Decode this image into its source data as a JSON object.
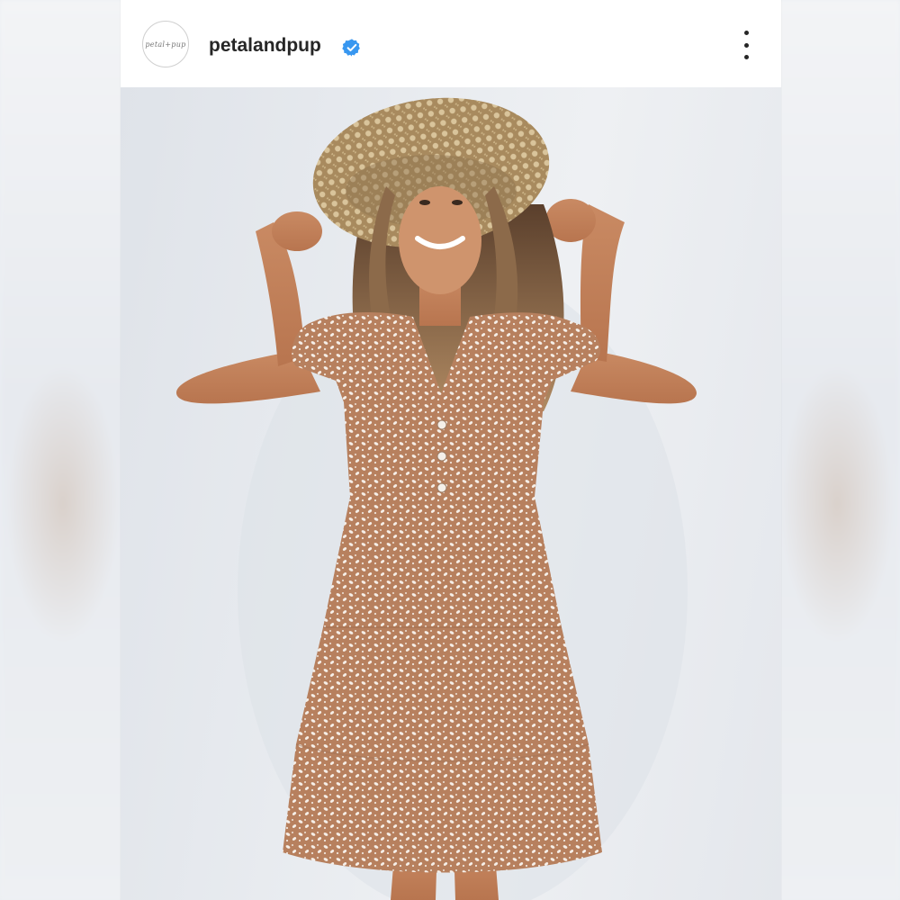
{
  "post": {
    "account": {
      "username": "petalandpup",
      "avatar_text": "petal+pup",
      "verified": true,
      "verified_icon": "verified-badge-icon",
      "verified_color": "#3897f0"
    },
    "menu_icon": "more-options-icon",
    "photo": {
      "subject": "model in floral tiered mini dress and wide straw hat",
      "background_color": "#e9ecf0",
      "dress_color": "#b7805e",
      "hat_color": "#b59a6e"
    }
  }
}
